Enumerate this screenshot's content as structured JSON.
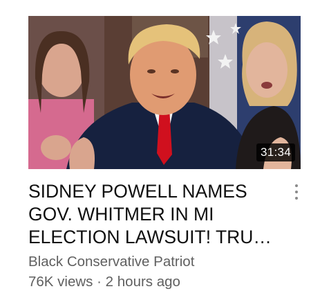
{
  "video": {
    "duration": "31:34",
    "title": "SIDNEY POWELL NAMES GOV. WHITMER IN MI ELECTION LAWSUIT! TRU…",
    "channel": "Black Conservative Patriot",
    "views": "76K views",
    "separator": "·",
    "age": "2 hours ago"
  },
  "icons": {
    "menu": "more-vert-icon"
  }
}
